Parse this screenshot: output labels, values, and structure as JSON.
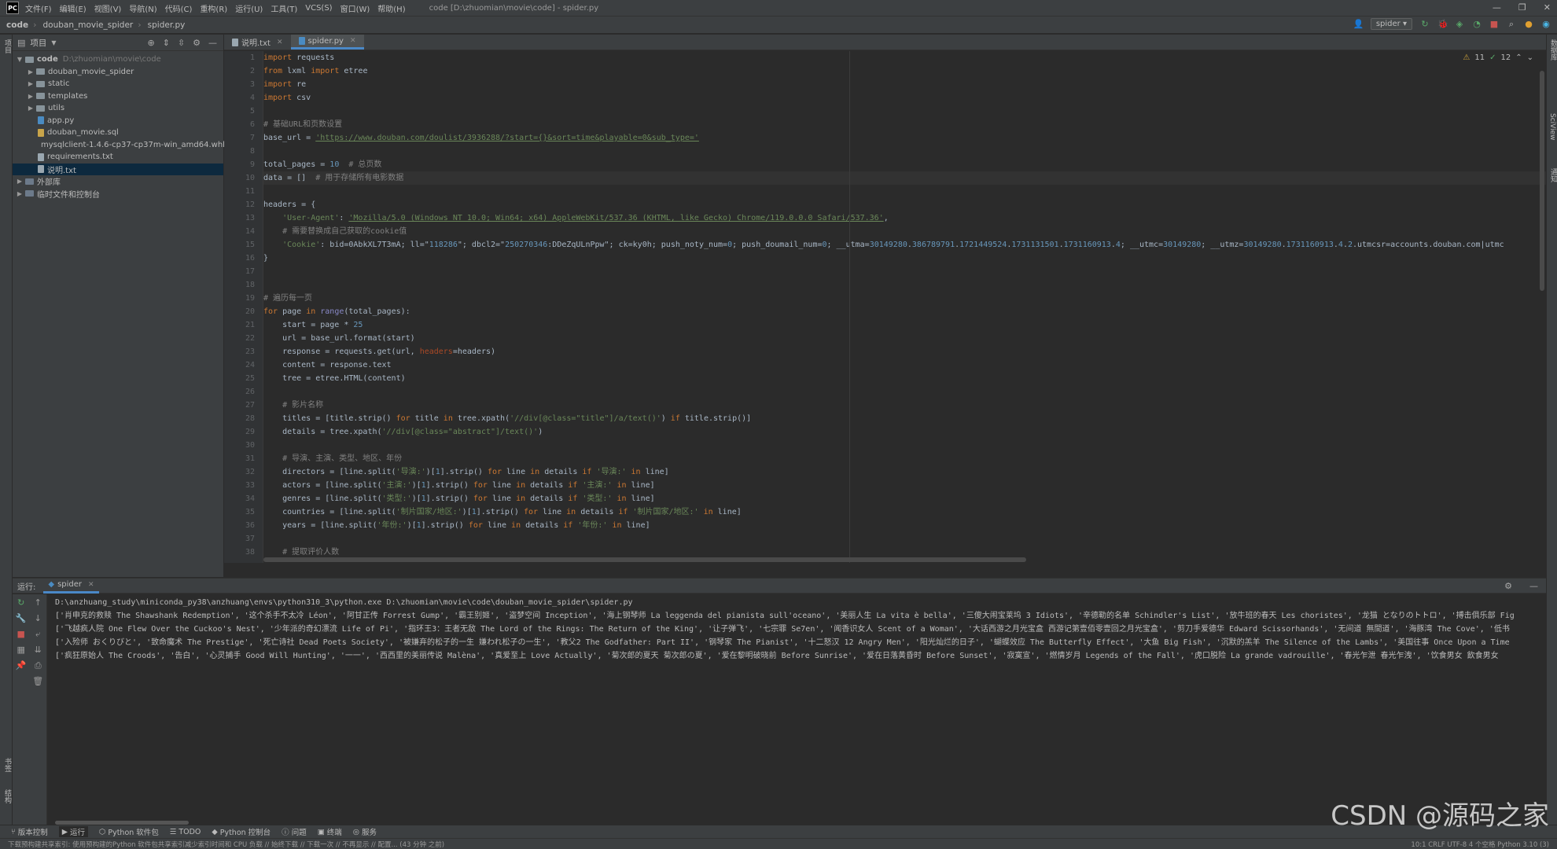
{
  "menubar": {
    "items": [
      "文件(F)",
      "编辑(E)",
      "视图(V)",
      "导航(N)",
      "代码(C)",
      "重构(R)",
      "运行(U)",
      "工具(T)",
      "VCS(S)",
      "窗口(W)",
      "帮助(H)"
    ],
    "window_title": "code [D:\\zhuomian\\movie\\code] - spider.py"
  },
  "nav": {
    "crumbs": [
      "code",
      "douban_movie_spider",
      "spider.py"
    ],
    "run_config": "spider"
  },
  "project": {
    "title": "项目",
    "root": {
      "name": "code",
      "path": "D:\\zhuomian\\movie\\code"
    },
    "items": [
      {
        "name": "douban_movie_spider",
        "type": "folder",
        "depth": 1
      },
      {
        "name": "static",
        "type": "folder",
        "depth": 1
      },
      {
        "name": "templates",
        "type": "folder",
        "depth": 1
      },
      {
        "name": "utils",
        "type": "folder",
        "depth": 1
      },
      {
        "name": "app.py",
        "type": "py",
        "depth": 1
      },
      {
        "name": "douban_movie.sql",
        "type": "sql",
        "depth": 1
      },
      {
        "name": "mysqlclient-1.4.6-cp37-cp37m-win_amd64.whl",
        "type": "whl",
        "depth": 1
      },
      {
        "name": "requirements.txt",
        "type": "txt",
        "depth": 1
      },
      {
        "name": "说明.txt",
        "type": "txt",
        "depth": 1,
        "selected": true
      },
      {
        "name": "外部库",
        "type": "lib",
        "depth": 0
      },
      {
        "name": "临时文件和控制台",
        "type": "lib",
        "depth": 0
      }
    ]
  },
  "editor": {
    "tabs": [
      {
        "label": "说明.txt",
        "active": false
      },
      {
        "label": "spider.py",
        "active": true
      }
    ],
    "inspections": {
      "warnings": "11",
      "ok": "12"
    },
    "current_line": 10,
    "lines": [
      "import requests",
      "from lxml import etree",
      "import re",
      "import csv",
      "",
      "# 基础URL和页数设置",
      "base_url = 'https://www.douban.com/doulist/3936288/?start={}&sort=time&playable=0&sub_type='",
      "",
      "total_pages = 10  # 总页数",
      "data = []  # 用于存储所有电影数据",
      "",
      "headers = {",
      "    'User-Agent': 'Mozilla/5.0 (Windows NT 10.0; Win64; x64) AppleWebKit/537.36 (KHTML, like Gecko) Chrome/119.0.0.0 Safari/537.36',",
      "    # 需要替换成自己获取的cookie值",
      "    'Cookie': 'bid=0AbkXL7T3mA; ll=\"118286\"; dbcl2=\"250270346:DDeZqULnPpw\"; ck=ky0h; push_noty_num=0; push_doumail_num=0; __utma=30149280.386789791.1721449524.1731131501.1731160913.4; __utmc=30149280; __utmz=30149280.1731160913.4.2.utmcsr=accounts.douban.com|utmc",
      "}",
      "",
      "",
      "# 遍历每一页",
      "for page in range(total_pages):",
      "    start = page * 25",
      "    url = base_url.format(start)",
      "    response = requests.get(url, headers=headers)",
      "    content = response.text",
      "    tree = etree.HTML(content)",
      "",
      "    # 影片名称",
      "    titles = [title.strip() for title in tree.xpath('//div[@class=\"title\"]/a/text()') if title.strip()]",
      "    details = tree.xpath('//div[@class=\"abstract\"]/text()')",
      "",
      "    # 导演、主演、类型、地区、年份",
      "    directors = [line.split('导演:')[1].strip() for line in details if '导演:' in line]",
      "    actors = [line.split('主演:')[1].strip() for line in details if '主演:' in line]",
      "    genres = [line.split('类型:')[1].strip() for line in details if '类型:' in line]",
      "    countries = [line.split('制片国家/地区:')[1].strip() for line in details if '制片国家/地区:' in line]",
      "    years = [line.split('年份:')[1].strip() for line in details if '年份:' in line]",
      "",
      "    # 提取评价人数"
    ]
  },
  "run": {
    "label": "运行:",
    "tab": "spider",
    "console": [
      "D:\\anzhuang_study\\miniconda_py38\\anzhuang\\envs\\python310_3\\python.exe D:\\zhuomian\\movie\\code\\douban_movie_spider\\spider.py",
      "['肖申克的救赎 The Shawshank Redemption', '这个杀手不太冷 Léon', '阿甘正传 Forrest Gump', '霸王别姬', '盗梦空间 Inception', '海上钢琴师 La leggenda del pianista sull'oceano', '美丽人生 La vita è bella', '三傻大闹宝莱坞 3 Idiots', '辛德勒的名单 Schindler's List', '放牛班的春天 Les choristes', '龙猫 となりのトトロ', '搏击俱乐部 Fig",
      "['飞越疯人院 One Flew Over the Cuckoo's Nest', '少年派的奇幻漂流 Life of Pi', '指环王3：王者无敌 The Lord of the Rings: The Return of the King', '让子弹飞', '七宗罪 Se7en', '闻香识女人 Scent of a Woman', '大话西游之月光宝盒 西游记第壹佰零壹回之月光宝盒', '剪刀手爱德华 Edward Scissorhands', '无间道 無間道', '海豚湾 The Cove', '低书",
      "['入殓师 おくりびと', '致命魔术 The Prestige', '死亡诗社 Dead Poets Society', '被嫌弃的松子的一生 嫌われ松子の一生', '教父2 The Godfather: Part II', '钢琴家 The Pianist', '十二怒汉 12 Angry Men', '阳光灿烂的日子', '蝴蝶效应 The Butterfly Effect', '大鱼 Big Fish', '沉默的羔羊 The Silence of the Lambs', '美国往事 Once Upon a Time",
      "['疯狂原始人 The Croods', '告白', '心灵捕手 Good Will Hunting', '一一', '西西里的美丽传说 Malèna', '真爱至上 Love Actually', '菊次郎的夏天 菊次郎の夏', '爱在黎明破晓前 Before Sunrise', '爱在日落黄昏时 Before Sunset', '寂寞宣', '燃情岁月 Legends of the Fall', '虎口脱险 La grande vadrouille', '春光乍泄 春光乍洩', '饮食男女 飲食男女"
    ]
  },
  "toolwindows": [
    "版本控制",
    "运行",
    "Python 软件包",
    "TODO",
    "Python 控制台",
    "问题",
    "终端",
    "服务"
  ],
  "status": {
    "message": "下载预构建共享索引: 使用预构建的Python 软件包共享索引减少索引时间和 CPU 负载 // 始终下载 // 下载一次 // 不再显示 // 配置... (43 分钟 之前)",
    "right": "10:1  CRLF  UTF-8  4 个空格  Python 3.10 (3)"
  },
  "watermark": "CSDN @源码之家"
}
